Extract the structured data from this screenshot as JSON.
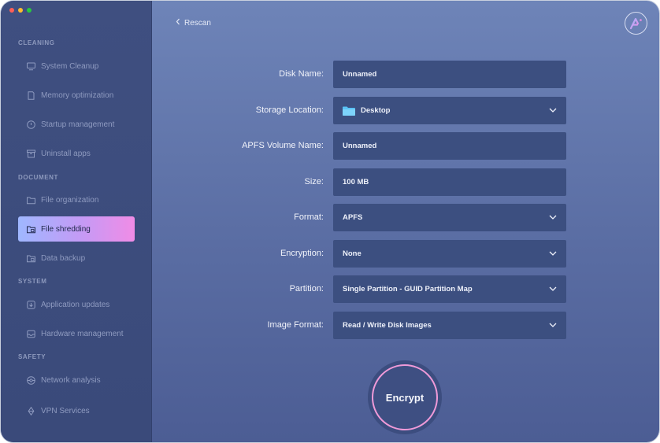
{
  "sidebar": {
    "sections": {
      "cleaning": "CLEANING",
      "document": "DOCUMENT",
      "system": "SYSTEM",
      "safety": "SAFETY"
    },
    "items": [
      {
        "label": "System Cleanup",
        "icon": "monitor-icon"
      },
      {
        "label": "Memory optimization",
        "icon": "memory-icon"
      },
      {
        "label": "Startup management",
        "icon": "power-icon"
      },
      {
        "label": "Uninstall apps",
        "icon": "archive-icon"
      },
      {
        "label": "File organization",
        "icon": "folder-icon"
      },
      {
        "label": "File shredding",
        "icon": "folder-shred-icon",
        "active": true
      },
      {
        "label": "Data backup",
        "icon": "folder-backup-icon"
      },
      {
        "label": "Application updates",
        "icon": "update-icon"
      },
      {
        "label": "Hardware management",
        "icon": "hardware-icon"
      },
      {
        "label": "Network analysis",
        "icon": "network-icon"
      },
      {
        "label": "VPN Services",
        "icon": "vpn-icon"
      }
    ]
  },
  "header": {
    "back_label": "Rescan",
    "logo_icon": "ai-logo-icon"
  },
  "form": {
    "disk_name": {
      "label": "Disk Name:",
      "value": "Unnamed"
    },
    "storage_location": {
      "label": "Storage Location:",
      "value": "Desktop"
    },
    "apfs_volume_name": {
      "label": "APFS Volume Name:",
      "value": "Unnamed"
    },
    "size": {
      "label": "Size:",
      "value": "100 MB"
    },
    "format": {
      "label": "Format:",
      "value": "APFS"
    },
    "encryption": {
      "label": "Encryption:",
      "value": "None"
    },
    "partition": {
      "label": "Partition:",
      "value": "Single Partition - GUID Partition Map"
    },
    "image_format": {
      "label": "Image Format:",
      "value": "Read / Write Disk Images"
    }
  },
  "encrypt_button": "Encrypt",
  "colors": {
    "accent_gradient_start": "#9fb7ff",
    "accent_gradient_end": "#f08ce6",
    "field_bg": "#3c4f80"
  }
}
